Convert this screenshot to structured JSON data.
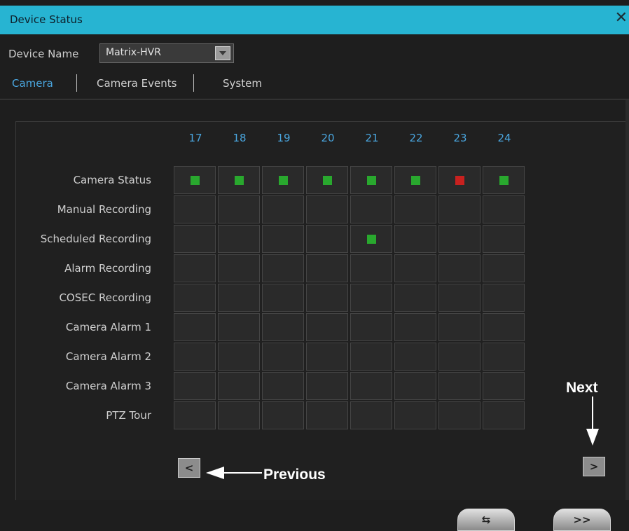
{
  "window": {
    "title": "Device Status",
    "close_glyph": "✕"
  },
  "device": {
    "label": "Device Name",
    "value": "Matrix-HVR",
    "icon": "chevron-down-icon"
  },
  "tabs": [
    {
      "label": "Camera",
      "active": true
    },
    {
      "label": "Camera Events",
      "active": false
    },
    {
      "label": "System",
      "active": false
    }
  ],
  "grid": {
    "columns": [
      "17",
      "18",
      "19",
      "20",
      "21",
      "22",
      "23",
      "24"
    ],
    "rows": [
      {
        "label": "Camera Status",
        "status": [
          "green",
          "green",
          "green",
          "green",
          "green",
          "green",
          "red",
          "green"
        ]
      },
      {
        "label": "Manual Recording",
        "status": [
          "",
          "",
          "",
          "",
          "",
          "",
          "",
          ""
        ]
      },
      {
        "label": "Scheduled Recording",
        "status": [
          "",
          "",
          "",
          "",
          "green",
          "",
          "",
          ""
        ]
      },
      {
        "label": "Alarm Recording",
        "status": [
          "",
          "",
          "",
          "",
          "",
          "",
          "",
          ""
        ]
      },
      {
        "label": "COSEC Recording",
        "status": [
          "",
          "",
          "",
          "",
          "",
          "",
          "",
          ""
        ]
      },
      {
        "label": "Camera Alarm 1",
        "status": [
          "",
          "",
          "",
          "",
          "",
          "",
          "",
          ""
        ]
      },
      {
        "label": "Camera Alarm 2",
        "status": [
          "",
          "",
          "",
          "",
          "",
          "",
          "",
          ""
        ]
      },
      {
        "label": "Camera Alarm 3",
        "status": [
          "",
          "",
          "",
          "",
          "",
          "",
          "",
          ""
        ]
      },
      {
        "label": "PTZ Tour",
        "status": [
          "",
          "",
          "",
          "",
          "",
          "",
          "",
          ""
        ]
      }
    ],
    "colors": {
      "green": "#29a82e",
      "red": "#c8211f"
    }
  },
  "nav": {
    "prev_glyph": "<",
    "next_glyph": ">"
  },
  "annotations": {
    "previous": "Previous",
    "next": "Next"
  },
  "footer": {
    "refresh_glyph": "⇆",
    "forward_label": ">>"
  }
}
